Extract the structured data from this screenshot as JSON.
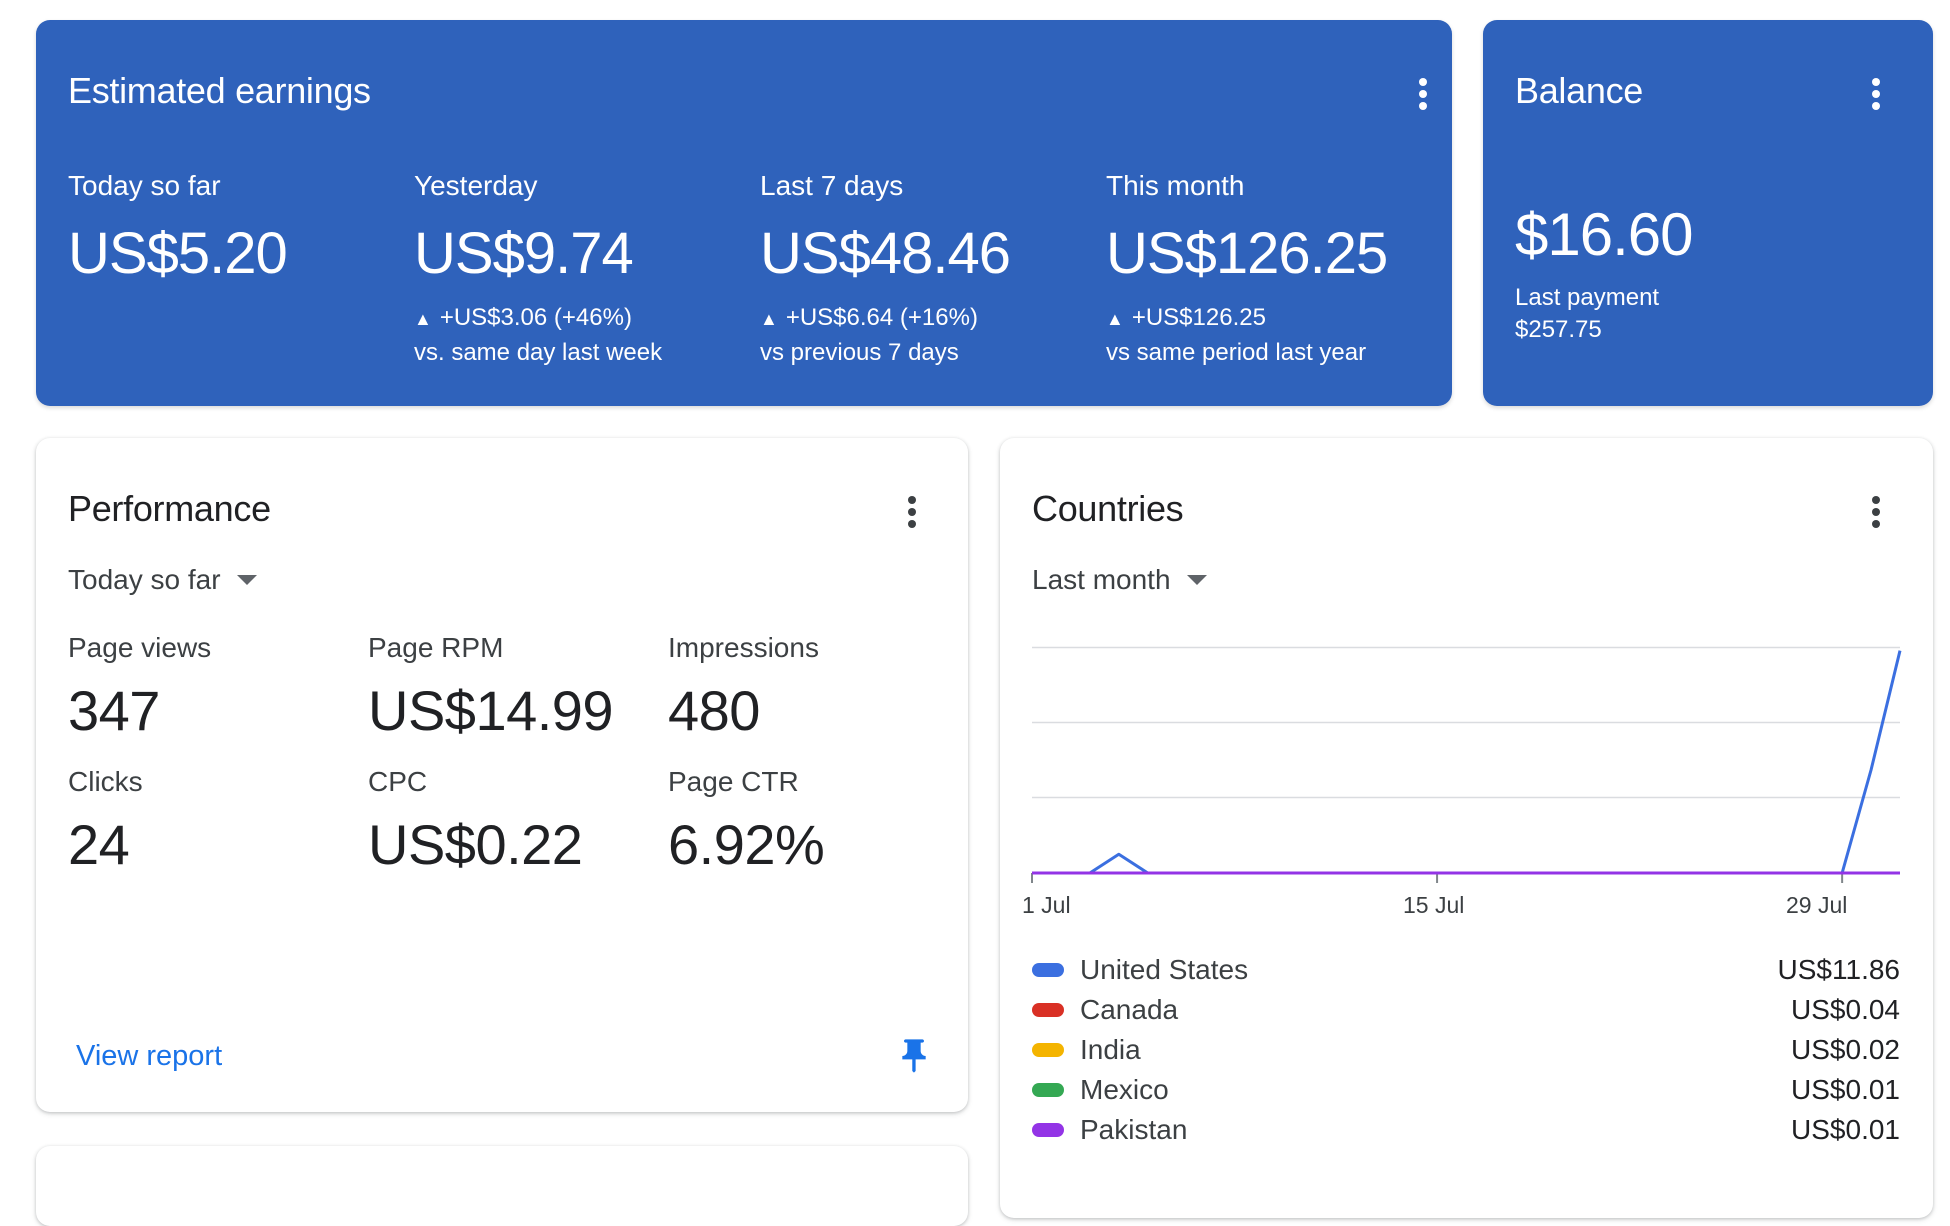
{
  "earnings": {
    "title": "Estimated earnings",
    "cols": [
      {
        "label": "Today so far",
        "value": "US$5.20",
        "delta": "",
        "compare": ""
      },
      {
        "label": "Yesterday",
        "value": "US$9.74",
        "delta": "+US$3.06 (+46%)",
        "compare": "vs. same day last week"
      },
      {
        "label": "Last 7 days",
        "value": "US$48.46",
        "delta": "+US$6.64 (+16%)",
        "compare": "vs previous 7 days"
      },
      {
        "label": "This month",
        "value": "US$126.25",
        "delta": "+US$126.25",
        "compare": "vs same period last year"
      }
    ],
    "up_glyph": "▲"
  },
  "balance": {
    "title": "Balance",
    "value": "$16.60",
    "last_payment_label": "Last payment",
    "last_payment_value": "$257.75"
  },
  "performance": {
    "title": "Performance",
    "range": "Today so far",
    "metrics": [
      {
        "label": "Page views",
        "value": "347"
      },
      {
        "label": "Page RPM",
        "value": "US$14.99"
      },
      {
        "label": "Impressions",
        "value": "480"
      },
      {
        "label": "Clicks",
        "value": "24"
      },
      {
        "label": "CPC",
        "value": "US$0.22"
      },
      {
        "label": "Page CTR",
        "value": "6.92%"
      }
    ],
    "view_report": "View report"
  },
  "countries": {
    "title": "Countries",
    "range": "Last month",
    "legend": [
      {
        "name": "United States",
        "value": "US$11.86",
        "color": "#3b6fe0"
      },
      {
        "name": "Canada",
        "value": "US$0.04",
        "color": "#d93025"
      },
      {
        "name": "India",
        "value": "US$0.02",
        "color": "#f4b400"
      },
      {
        "name": "Mexico",
        "value": "US$0.01",
        "color": "#34a853"
      },
      {
        "name": "Pakistan",
        "value": "US$0.01",
        "color": "#9334e6"
      }
    ]
  },
  "chart_data": {
    "type": "line",
    "x_tick_labels": [
      "1 Jul",
      "15 Jul",
      "29 Jul"
    ],
    "x_domain": [
      1,
      31
    ],
    "ylim": [
      0,
      12
    ],
    "grid": true,
    "series": [
      {
        "name": "United States",
        "color": "#3b6fe0",
        "x": [
          1,
          2,
          3,
          4,
          5,
          28,
          29,
          30,
          31
        ],
        "y": [
          0,
          0,
          0,
          1,
          0,
          0,
          0,
          5.5,
          11.86
        ]
      },
      {
        "name": "Pakistan",
        "color": "#9334e6",
        "x": [
          1,
          31
        ],
        "y": [
          0,
          0
        ]
      }
    ]
  }
}
